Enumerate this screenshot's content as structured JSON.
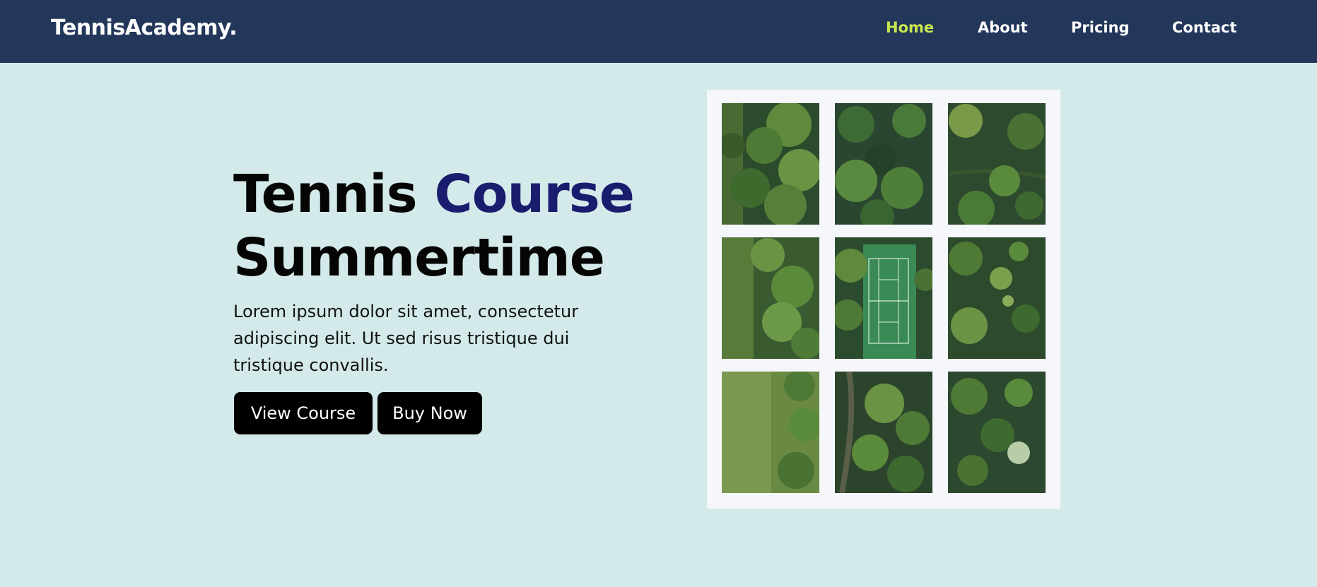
{
  "navbar": {
    "brand": "TennisAcademy.",
    "links": [
      {
        "label": "Home",
        "active": true
      },
      {
        "label": "About",
        "active": false
      },
      {
        "label": "Pricing",
        "active": false
      },
      {
        "label": "Contact",
        "active": false
      }
    ]
  },
  "hero": {
    "title_part1": "Tennis ",
    "title_accent": "Course",
    "title_line2": "Summertime",
    "description": "Lorem ipsum dolor sit amet, consectetur adipiscing elit. Ut sed risus tristique dui tristique convallis.",
    "buttons": {
      "view_course": "View Course",
      "buy_now": "Buy Now"
    }
  },
  "gallery": {
    "tiles": [
      {
        "subject": "aerial-trees"
      },
      {
        "subject": "aerial-trees"
      },
      {
        "subject": "aerial-trees"
      },
      {
        "subject": "aerial-trees-grass"
      },
      {
        "subject": "aerial-tennis-court"
      },
      {
        "subject": "aerial-trees-bushes"
      },
      {
        "subject": "aerial-grass-field"
      },
      {
        "subject": "aerial-trees-path"
      },
      {
        "subject": "aerial-trees"
      }
    ]
  },
  "colors": {
    "navbar_bg": "#22375a",
    "page_bg": "#d4eaea",
    "nav_active": "#cbe84f",
    "accent": "#1a1d6e",
    "button_bg": "#000000",
    "gallery_frame": "#f5f7fb"
  }
}
